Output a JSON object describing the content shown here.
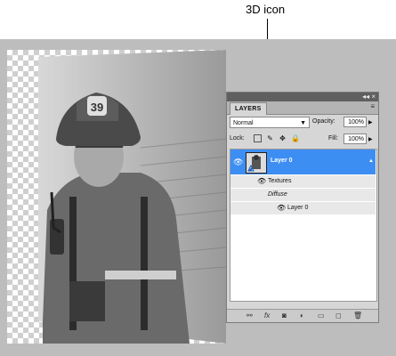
{
  "callout": {
    "text": "3D icon"
  },
  "panel": {
    "tab_label": "LAYERS",
    "topbar_controls": "◂◂ ×",
    "menu_icon": "≡",
    "blend_mode": "Normal",
    "opacity_label": "Opacity:",
    "opacity_value": "100%",
    "lock_label": "Lock:",
    "fill_label": "Fill:",
    "fill_value": "100%",
    "layers": [
      {
        "name": "Layer 0",
        "type": "3d-layer",
        "selected": true
      }
    ],
    "sub_items": {
      "textures": "Textures",
      "diffuse": "Diffuse",
      "texture_layer": "Layer 0"
    },
    "bottom_icons": [
      "link-icon",
      "fx-icon",
      "mask-icon",
      "adjustment-icon",
      "group-icon",
      "new-layer-icon",
      "trash-icon"
    ]
  },
  "colors": {
    "selection": "#3d8ef3",
    "workspace": "#bdbdbd",
    "panel": "#d6d6d6"
  }
}
